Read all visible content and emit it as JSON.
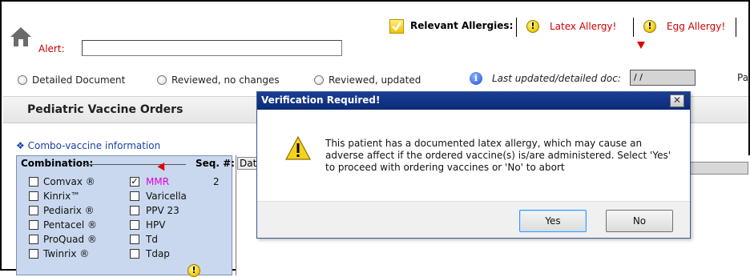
{
  "header": {
    "alert_label": "Alert:",
    "alert_value": "",
    "relevant_allergies_label": "Relevant Allergies:",
    "allergies": [
      "Latex Allergy!",
      "Egg Allergy!"
    ]
  },
  "review": {
    "options": [
      "Detailed Document",
      "Reviewed, no changes",
      "Reviewed, updated"
    ],
    "last_updated_label": "Last updated/detailed doc:",
    "last_updated_value": "/ /",
    "truncated_right_label": "Pa"
  },
  "section": {
    "title": "Pediatric Vaccine Orders",
    "combo_link": "Combo-vaccine information",
    "combination_header": "Combination:",
    "seq_header": "Seq. #:",
    "left_vaccines": [
      "Comvax ®",
      "Kinrix™",
      "Pediarix ®",
      "Pentacel ®",
      "ProQuad ®",
      "Twinrix ®"
    ],
    "right_vaccines": [
      {
        "label": "MMR",
        "checked": true,
        "seq": "2"
      },
      {
        "label": "Varicella",
        "checked": false,
        "seq": ""
      },
      {
        "label": "PPV 23",
        "checked": false,
        "seq": ""
      },
      {
        "label": "HPV",
        "checked": false,
        "seq": ""
      },
      {
        "label": "Td",
        "checked": false,
        "seq": ""
      },
      {
        "label": "Tdap",
        "checked": false,
        "seq": ""
      }
    ],
    "grid_header": "Dat"
  },
  "dialog": {
    "title": "Verification Required!",
    "close_glyph": "✕",
    "message": "This patient has a documented latex allergy, which may cause an adverse affect if the ordered vaccine(s) is/are administered. Select 'Yes' to proceed with ordering vaccines or 'No' to abort",
    "yes_label": "Yes",
    "no_label": "No"
  },
  "colors": {
    "alert_red": "#d00000",
    "dialog_title_bar": "#0b2a78",
    "panel_blue": "#c9d8ee",
    "mmr_magenta": "#e000e0"
  }
}
